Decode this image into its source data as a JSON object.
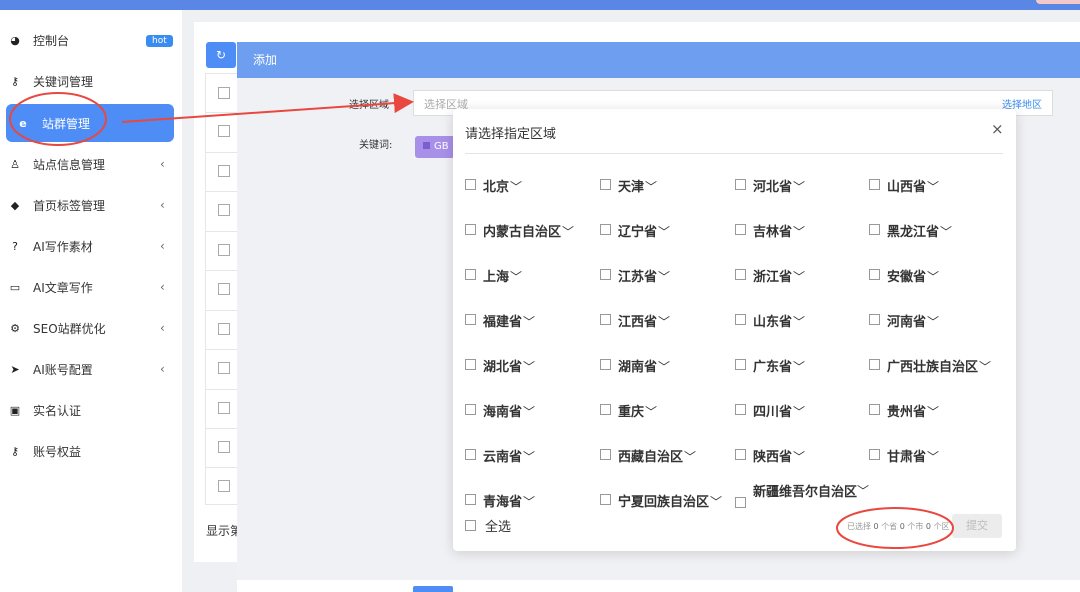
{
  "sidebar": {
    "items": [
      {
        "label": "控制台",
        "badge": "hot"
      },
      {
        "label": "关键词管理"
      },
      {
        "label": "站群管理"
      },
      {
        "label": "站点信息管理",
        "chevron": "‹"
      },
      {
        "label": "首页标签管理",
        "chevron": "‹"
      },
      {
        "label": "AI写作素材",
        "chevron": "‹"
      },
      {
        "label": "AI文章写作",
        "chevron": "‹"
      },
      {
        "label": "SEO站群优化",
        "chevron": "‹"
      },
      {
        "label": "AI账号配置",
        "chevron": "‹"
      },
      {
        "label": "实名认证"
      },
      {
        "label": "账号权益"
      }
    ]
  },
  "main": {
    "page_info": "显示第"
  },
  "add_dialog": {
    "title": "添加",
    "region_label": "选择区域",
    "region_placeholder": "选择区域",
    "choose_region": "选择地区",
    "keyword_label": "关键词:",
    "gb_button": "GB"
  },
  "region_modal": {
    "title": "请选择指定区域",
    "close": "×",
    "provinces": [
      "北京",
      "天津",
      "河北省",
      "山西省",
      "内蒙古自治区",
      "辽宁省",
      "吉林省",
      "黑龙江省",
      "上海",
      "江苏省",
      "浙江省",
      "安徽省",
      "福建省",
      "江西省",
      "山东省",
      "河南省",
      "湖北省",
      "湖南省",
      "广东省",
      "广西壮族自治区",
      "海南省",
      "重庆",
      "四川省",
      "贵州省",
      "云南省",
      "西藏自治区",
      "陕西省",
      "甘肃省",
      "青海省",
      "宁夏回族自治区",
      "新疆维吾尔自治区"
    ],
    "dropdown_glyph": "﹀",
    "select_all": "全选",
    "summary": {
      "prefix": "已选择",
      "prov_count": "0",
      "prov_unit": "个省",
      "city_count": "0",
      "city_unit": "个市",
      "dist_count": "0",
      "dist_unit": "个区"
    },
    "submit": "提交"
  },
  "colors": {
    "accent": "#4e8df6",
    "annotation": "#e8483f",
    "header": "#6d9ef0"
  }
}
